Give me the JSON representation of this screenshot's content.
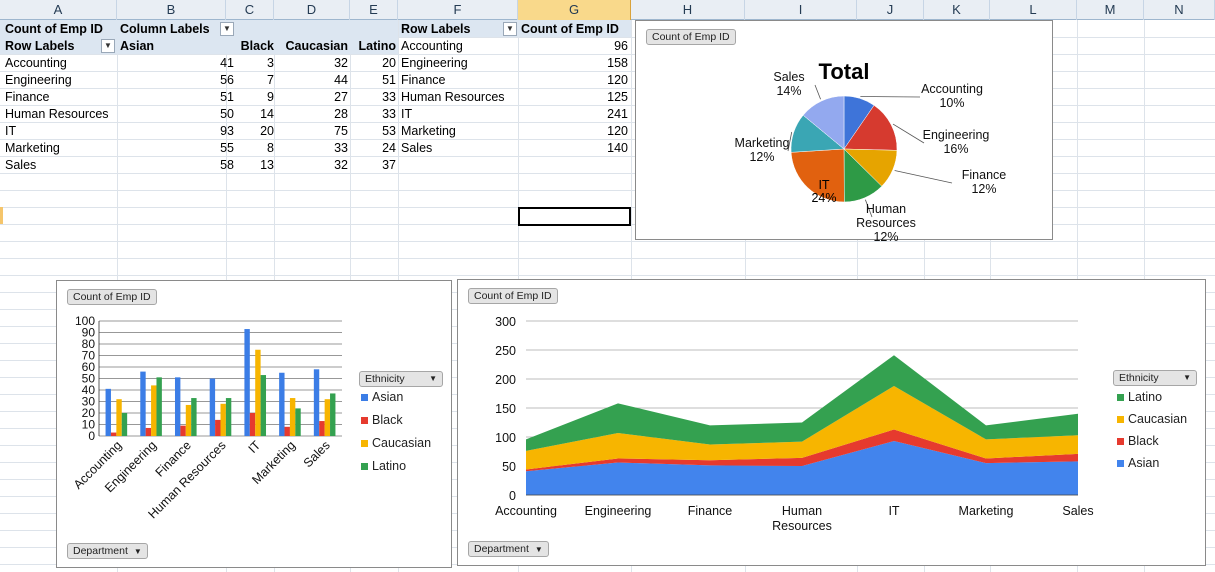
{
  "columns": [
    "A",
    "B",
    "C",
    "D",
    "E",
    "F",
    "G",
    "H",
    "I",
    "J",
    "K",
    "L",
    "M",
    "N"
  ],
  "selected_column": "G",
  "pivot1": {
    "corner": "Count of  Emp ID",
    "column_labels": "Column Labels",
    "row_labels": "Row Labels",
    "headers": [
      "Asian",
      "Black",
      "Caucasian",
      "Latino"
    ],
    "rows": [
      {
        "label": "Accounting",
        "values": [
          41,
          3,
          32,
          20
        ]
      },
      {
        "label": "Engineering",
        "values": [
          56,
          7,
          44,
          51
        ]
      },
      {
        "label": "Finance",
        "values": [
          51,
          9,
          27,
          33
        ]
      },
      {
        "label": "Human Resources",
        "values": [
          50,
          14,
          28,
          33
        ]
      },
      {
        "label": "IT",
        "values": [
          93,
          20,
          75,
          53
        ]
      },
      {
        "label": "Marketing",
        "values": [
          55,
          8,
          33,
          24
        ]
      },
      {
        "label": "Sales",
        "values": [
          58,
          13,
          32,
          37
        ]
      }
    ]
  },
  "pivot2": {
    "row_labels": "Row Labels",
    "count_label": "Count of  Emp ID",
    "rows": [
      {
        "label": "Accounting",
        "value": 96
      },
      {
        "label": "Engineering",
        "value": 158
      },
      {
        "label": "Finance",
        "value": 120
      },
      {
        "label": "Human Resources",
        "value": 125
      },
      {
        "label": "IT",
        "value": 241
      },
      {
        "label": "Marketing",
        "value": 120
      },
      {
        "label": "Sales",
        "value": 140
      }
    ]
  },
  "pie_chart": {
    "field_button": "Count of  Emp ID",
    "title": "Total"
  },
  "bar_chart": {
    "field_button": "Count of  Emp ID",
    "legend_button": "Ethnicity",
    "axis_button": "Department"
  },
  "area_chart": {
    "field_button": "Count of  Emp ID",
    "legend_button": "Ethnicity",
    "axis_button": "Department"
  },
  "chart_data": [
    {
      "type": "pie",
      "title": "Total",
      "labels": [
        "Accounting",
        "Engineering",
        "Finance",
        "Human Resources",
        "IT",
        "Marketing",
        "Sales"
      ],
      "values": [
        96,
        158,
        120,
        125,
        241,
        120,
        140
      ],
      "percent_labels": [
        "10%",
        "16%",
        "12%",
        "12%",
        "24%",
        "12%",
        "14%"
      ],
      "colors": [
        "#3e74d9",
        "#d63a2f",
        "#e6a400",
        "#2e9a46",
        "#e1610f",
        "#3aa6b4",
        "#93a9ef"
      ]
    },
    {
      "type": "bar",
      "categories": [
        "Accounting",
        "Engineering",
        "Finance",
        "Human Resources",
        "IT",
        "Marketing",
        "Sales"
      ],
      "series": [
        {
          "name": "Asian",
          "values": [
            41,
            56,
            51,
            50,
            93,
            55,
            58
          ],
          "color": "#3b7de6"
        },
        {
          "name": "Black",
          "values": [
            3,
            7,
            9,
            14,
            20,
            8,
            13
          ],
          "color": "#e63a2e"
        },
        {
          "name": "Caucasian",
          "values": [
            32,
            44,
            27,
            28,
            75,
            33,
            32
          ],
          "color": "#f7b500"
        },
        {
          "name": "Latino",
          "values": [
            20,
            51,
            33,
            33,
            53,
            24,
            37
          ],
          "color": "#34a150"
        }
      ],
      "ylim": [
        0,
        100
      ],
      "yticks": [
        0,
        10,
        20,
        30,
        40,
        50,
        60,
        70,
        80,
        90,
        100
      ],
      "grid": true,
      "legend": "right"
    },
    {
      "type": "area",
      "stacked": true,
      "categories": [
        "Accounting",
        "Engineering",
        "Finance",
        "Human Resources",
        "IT",
        "Marketing",
        "Sales"
      ],
      "series": [
        {
          "name": "Asian",
          "values": [
            41,
            56,
            51,
            50,
            93,
            55,
            58
          ],
          "color": "#4284ed"
        },
        {
          "name": "Black",
          "values": [
            3,
            7,
            9,
            14,
            20,
            8,
            13
          ],
          "color": "#e63a2e"
        },
        {
          "name": "Caucasian",
          "values": [
            32,
            44,
            27,
            28,
            75,
            33,
            32
          ],
          "color": "#f7b500"
        },
        {
          "name": "Latino",
          "values": [
            20,
            51,
            33,
            33,
            53,
            24,
            37
          ],
          "color": "#34a150"
        }
      ],
      "legend_order": [
        "Latino",
        "Caucasian",
        "Black",
        "Asian"
      ],
      "ylim": [
        0,
        300
      ],
      "yticks": [
        0,
        50,
        100,
        150,
        200,
        250,
        300
      ],
      "grid": true,
      "legend": "right"
    }
  ]
}
